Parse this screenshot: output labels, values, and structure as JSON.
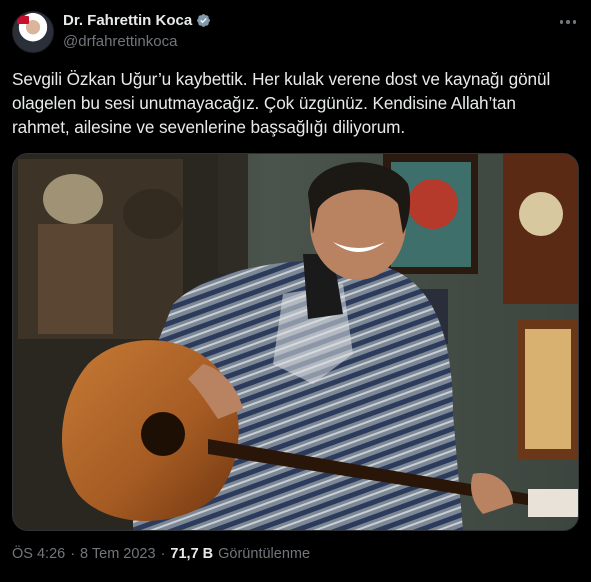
{
  "author": {
    "display_name": "Dr. Fahrettin Koca",
    "handle": "@drfahrettinkoca",
    "verified": true
  },
  "tweet": {
    "lines": [
      "Sevgili Özkan Uğur’u kaybettik. Her kulak verene dost ve kaynağı gönül",
      "olagelen bu sesi unutmayacağız. Çok üzgünüz. Kendisine Allah’tan",
      "rahmet, ailesine ve sevenlerine başsağlığı diliyorum."
    ]
  },
  "meta": {
    "time": "ÖS 4:26",
    "separator": "·",
    "date": "8 Tem 2023",
    "views_count": "71,7 B",
    "views_label": "Görüntülenme"
  },
  "icons": {
    "verified": "verified-badge-icon",
    "more": "more-horizontal-icon"
  },
  "colors": {
    "background": "#000000",
    "text": "#e7e9ea",
    "secondary": "#71767b",
    "verified": "#829aab"
  }
}
